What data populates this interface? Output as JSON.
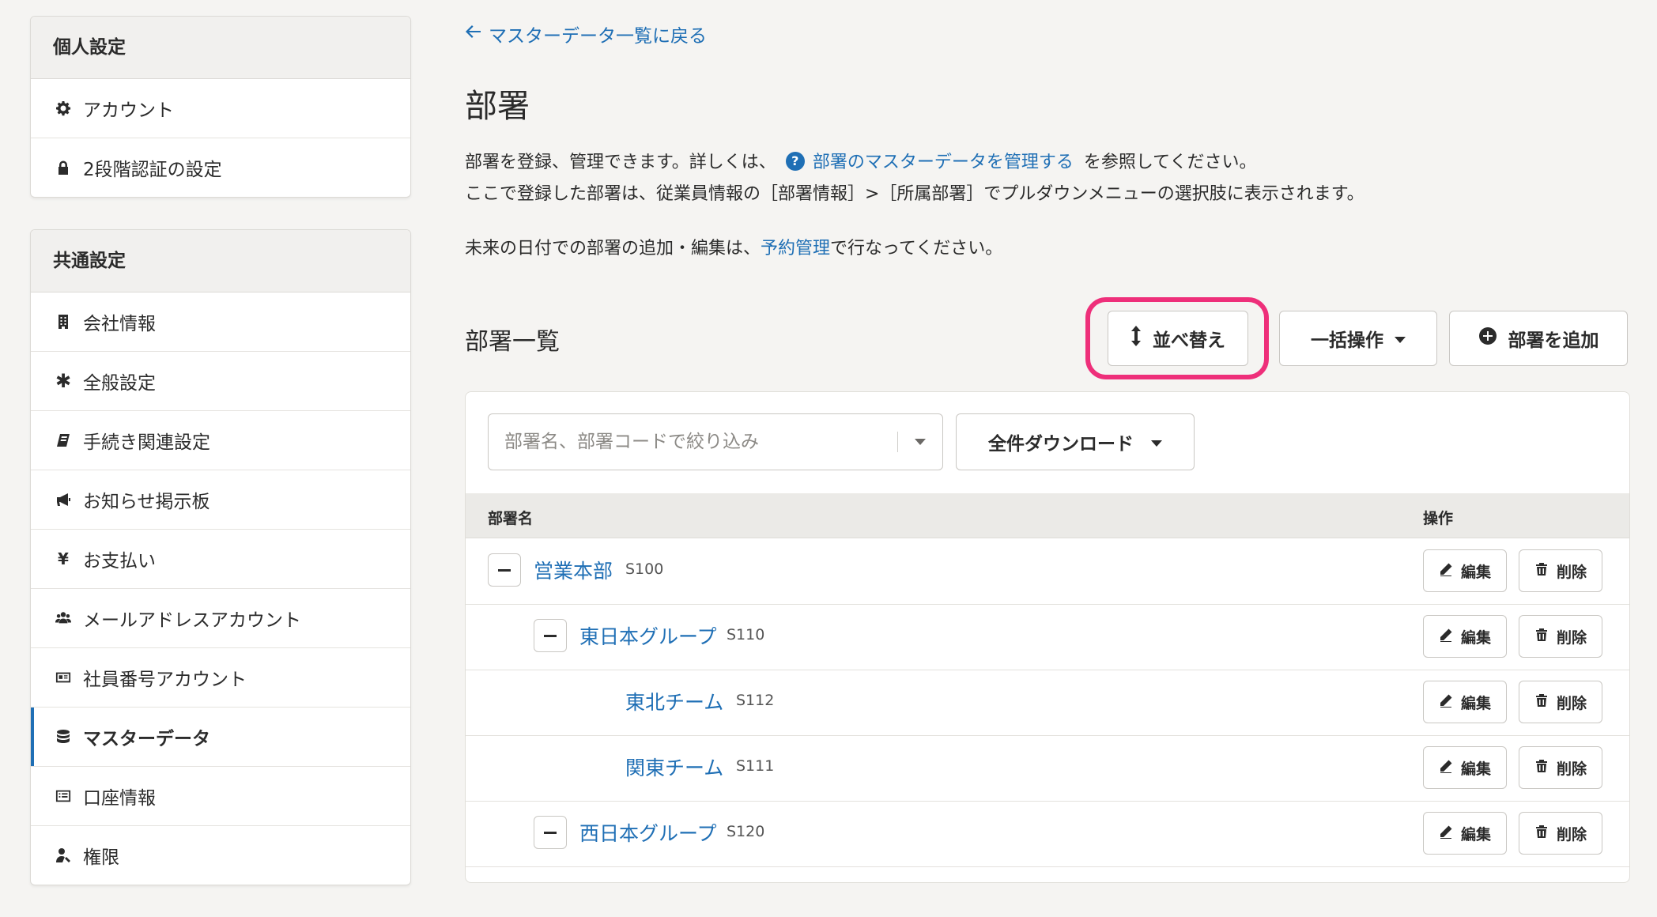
{
  "sidebar": {
    "personal": {
      "title": "個人設定",
      "items": [
        {
          "label": "アカウント",
          "icon": "gear-icon"
        },
        {
          "label": "2段階認証の設定",
          "icon": "lock-icon"
        }
      ]
    },
    "common": {
      "title": "共通設定",
      "items": [
        {
          "label": "会社情報",
          "icon": "building-icon"
        },
        {
          "label": "全般設定",
          "icon": "asterisk-icon"
        },
        {
          "label": "手続き関連設定",
          "icon": "book-icon"
        },
        {
          "label": "お知らせ掲示板",
          "icon": "megaphone-icon"
        },
        {
          "label": "お支払い",
          "icon": "yen-icon"
        },
        {
          "label": "メールアドレスアカウント",
          "icon": "users-icon"
        },
        {
          "label": "社員番号アカウント",
          "icon": "id-card-icon"
        },
        {
          "label": "マスターデータ",
          "icon": "database-icon",
          "active": true
        },
        {
          "label": "口座情報",
          "icon": "list-icon"
        },
        {
          "label": "権限",
          "icon": "user-key-icon"
        }
      ]
    }
  },
  "main": {
    "back_link": "マスターデータ一覧に戻る",
    "title": "部署",
    "desc1_pre": "部署を登録、管理できます。詳しくは、",
    "desc1_link": "部署のマスターデータを管理する",
    "desc1_post": "を参照してください。",
    "desc2": "ここで登録した部署は、従業員情報の［部署情報］>［所属部署］でプルダウンメニューの選択肢に表示されます。",
    "desc3_pre": "未来の日付での部署の追加・編集は、",
    "desc3_link": "予約管理",
    "desc3_post": "で行なってください。",
    "section_title": "部署一覧",
    "buttons": {
      "sort": "並べ替え",
      "bulk": "一括操作",
      "add": "部署を追加"
    },
    "filter_placeholder": "部署名、部署コードで絞り込み",
    "download": "全件ダウンロード",
    "table": {
      "col_name": "部署名",
      "col_actions": "操作",
      "edit": "編集",
      "delete": "削除",
      "rows": [
        {
          "name": "営業本部",
          "code": "S100"
        },
        {
          "name": "東日本グループ",
          "code": "S110"
        },
        {
          "name": "東北チーム",
          "code": "S112"
        },
        {
          "name": "関東チーム",
          "code": "S111"
        },
        {
          "name": "西日本グループ",
          "code": "S120"
        }
      ]
    }
  },
  "colors": {
    "accent": "#1f6fb5",
    "highlight": "#ee2f7a"
  }
}
